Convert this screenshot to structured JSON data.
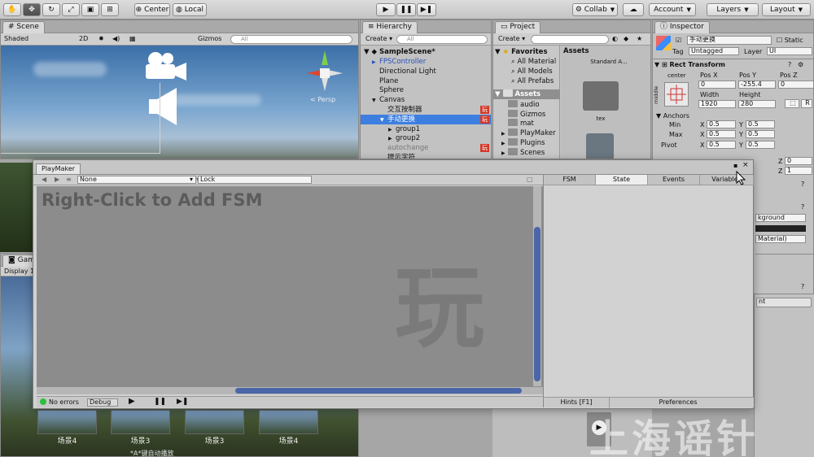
{
  "toolbar": {
    "tools": [
      "hand-tool-icon",
      "move-tool-icon",
      "rotate-tool-icon",
      "scale-tool-icon",
      "rect-tool-icon",
      "transform-tool-icon"
    ],
    "pivot_label": "Center",
    "space_label": "Local",
    "collab_label": "Collab",
    "account_label": "Account",
    "layers_label": "Layers",
    "layout_label": "Layout"
  },
  "scene": {
    "tab_label": "Scene",
    "shading": "Shaded",
    "mode_2d": "2D",
    "gizmos": "Gizmos",
    "search_placeholder": "All",
    "persp_label": "< Persp"
  },
  "hierarchy": {
    "tab_label": "Hierarchy",
    "create_label": "Create",
    "search_placeholder": "All",
    "scene_name": "SampleScene*",
    "items": [
      {
        "label": "FPSController",
        "indent": 1,
        "arrow": "▶",
        "color": "#2a4fbf",
        "selected": false,
        "badge": ""
      },
      {
        "label": "Directional Light",
        "indent": 1,
        "arrow": "",
        "color": "#111",
        "selected": false,
        "badge": ""
      },
      {
        "label": "Plane",
        "indent": 1,
        "arrow": "",
        "color": "#111",
        "selected": false,
        "badge": ""
      },
      {
        "label": "Sphere",
        "indent": 1,
        "arrow": "",
        "color": "#111",
        "selected": false,
        "badge": ""
      },
      {
        "label": "Canvas",
        "indent": 1,
        "arrow": "▼",
        "color": "#111",
        "selected": false,
        "badge": ""
      },
      {
        "label": "交互按制器",
        "indent": 2,
        "arrow": "",
        "color": "#111",
        "selected": false,
        "badge": "玩"
      },
      {
        "label": "手动更换",
        "indent": 2,
        "arrow": "▼",
        "color": "#fff",
        "selected": true,
        "badge": "玩"
      },
      {
        "label": "group1",
        "indent": 3,
        "arrow": "▶",
        "color": "#111",
        "selected": false,
        "badge": ""
      },
      {
        "label": "group2",
        "indent": 3,
        "arrow": "▶",
        "color": "#111",
        "selected": false,
        "badge": ""
      },
      {
        "label": "autochange",
        "indent": 2,
        "arrow": "",
        "color": "#777",
        "selected": false,
        "badge": "玩"
      },
      {
        "label": "提示字符",
        "indent": 2,
        "arrow": "",
        "color": "#111",
        "selected": false,
        "badge": ""
      }
    ]
  },
  "project": {
    "tab_label": "Project",
    "create_label": "Create",
    "favorites_label": "Favorites",
    "favorites": [
      "All Material",
      "All Models",
      "All Prefabs"
    ],
    "assets_label": "Assets",
    "folders": [
      "audio",
      "Gizmos",
      "mat",
      "PlayMaker",
      "Plugins",
      "Scenes"
    ],
    "grid_title": "Assets",
    "grid_items": [
      "Standard A...",
      "tex"
    ]
  },
  "inspector": {
    "tab_label": "Inspector",
    "object_name": "手动更换",
    "static_label": "Static",
    "tag_label": "Tag",
    "tag_value": "Untagged",
    "layer_label": "Layer",
    "layer_value": "UI",
    "component_title": "Rect Transform",
    "anchor_label": "center",
    "middle_label": "middle",
    "pos_x_label": "Pos X",
    "pos_y_label": "Pos Y",
    "pos_z_label": "Pos Z",
    "pos_x": "0",
    "pos_y": "-255.4",
    "pos_z": "0",
    "width_label": "Width",
    "height_label": "Height",
    "width": "1920",
    "height": "280",
    "raw_btn": "R",
    "anchors_label": "Anchors",
    "min_label": "Min",
    "max_label": "Max",
    "pivot_label": "Pivot",
    "x_label": "X",
    "y_label": "Y",
    "z_label": "Z",
    "min_x": "0.5",
    "min_y": "0.5",
    "max_x": "0.5",
    "max_y": "0.5",
    "pivot_x": "0.5",
    "pivot_y": "0.5",
    "rot_z": "0",
    "scale_z": "1",
    "partial_1": "kground",
    "partial_2": "Material)",
    "partial_3": "nt"
  },
  "game": {
    "tab_label": "Game",
    "display_label": "Display 1",
    "thumbs": [
      "场景4",
      "场景3",
      "场景3",
      "场景4"
    ],
    "caption": "*A*键自动播放"
  },
  "playmaker": {
    "tab_label": "PlayMaker",
    "fsm_select": "None",
    "lock_label": "Lock",
    "hint_text": "Right-Click to Add FSM",
    "right_tabs": [
      "FSM",
      "State",
      "Events",
      "Variables"
    ],
    "status_errors": "No errors",
    "debug_label": "Debug",
    "hints_label": "Hints [F1]",
    "preferences_label": "Preferences"
  },
  "watermark": {
    "char": "玩",
    "text": "上海谣针"
  }
}
